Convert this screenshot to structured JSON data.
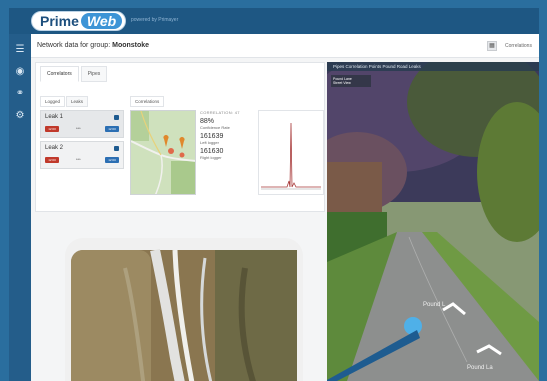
{
  "brand": {
    "name_part1": "Prime",
    "name_part2": "Web",
    "powered_by": "powered by Primayer"
  },
  "sidebar": {
    "icons": [
      "menu-icon",
      "globe-icon",
      "share-icon",
      "settings-icon"
    ]
  },
  "header": {
    "title_prefix": "Network data for group:",
    "title_group": "Moonstoke",
    "grid_icon": "grid-icon",
    "link": "Correlations"
  },
  "tabs": [
    {
      "label": "Correlators",
      "active": true
    },
    {
      "label": "Pipes",
      "active": false
    }
  ],
  "subtabs": [
    {
      "label": "Logged",
      "active": true
    },
    {
      "label": "Leaks",
      "active": false
    }
  ],
  "correlations_tab": "Correlations",
  "leaks": [
    {
      "name": "Leak 1",
      "selected": true,
      "left_badge": "12:00",
      "mid": "***",
      "right_badge": "12:00"
    },
    {
      "name": "Leak 2",
      "selected": false,
      "left_badge": "12:00",
      "mid": "***",
      "right_badge": "12:00"
    }
  ],
  "correlation": {
    "heading": "CORRELATION: 47",
    "confidence_value": "88%",
    "confidence_label": "Confidence Rate",
    "left_value": "161639",
    "left_label": "Left logger",
    "right_value": "161630",
    "right_label": "Right logger"
  },
  "streetview": {
    "toolbar": "Pipes   Correlation Points   Pound Road   Leaks",
    "info_title": "Pound Lane",
    "info_sub": "Street View",
    "road_label_1": "Pound L",
    "road_label_2": "Pound La"
  },
  "colors": {
    "brand": "#1e5783",
    "accent": "#3d94d6",
    "leak_marker": "#4fb0e8",
    "alert": "#c0392b"
  }
}
